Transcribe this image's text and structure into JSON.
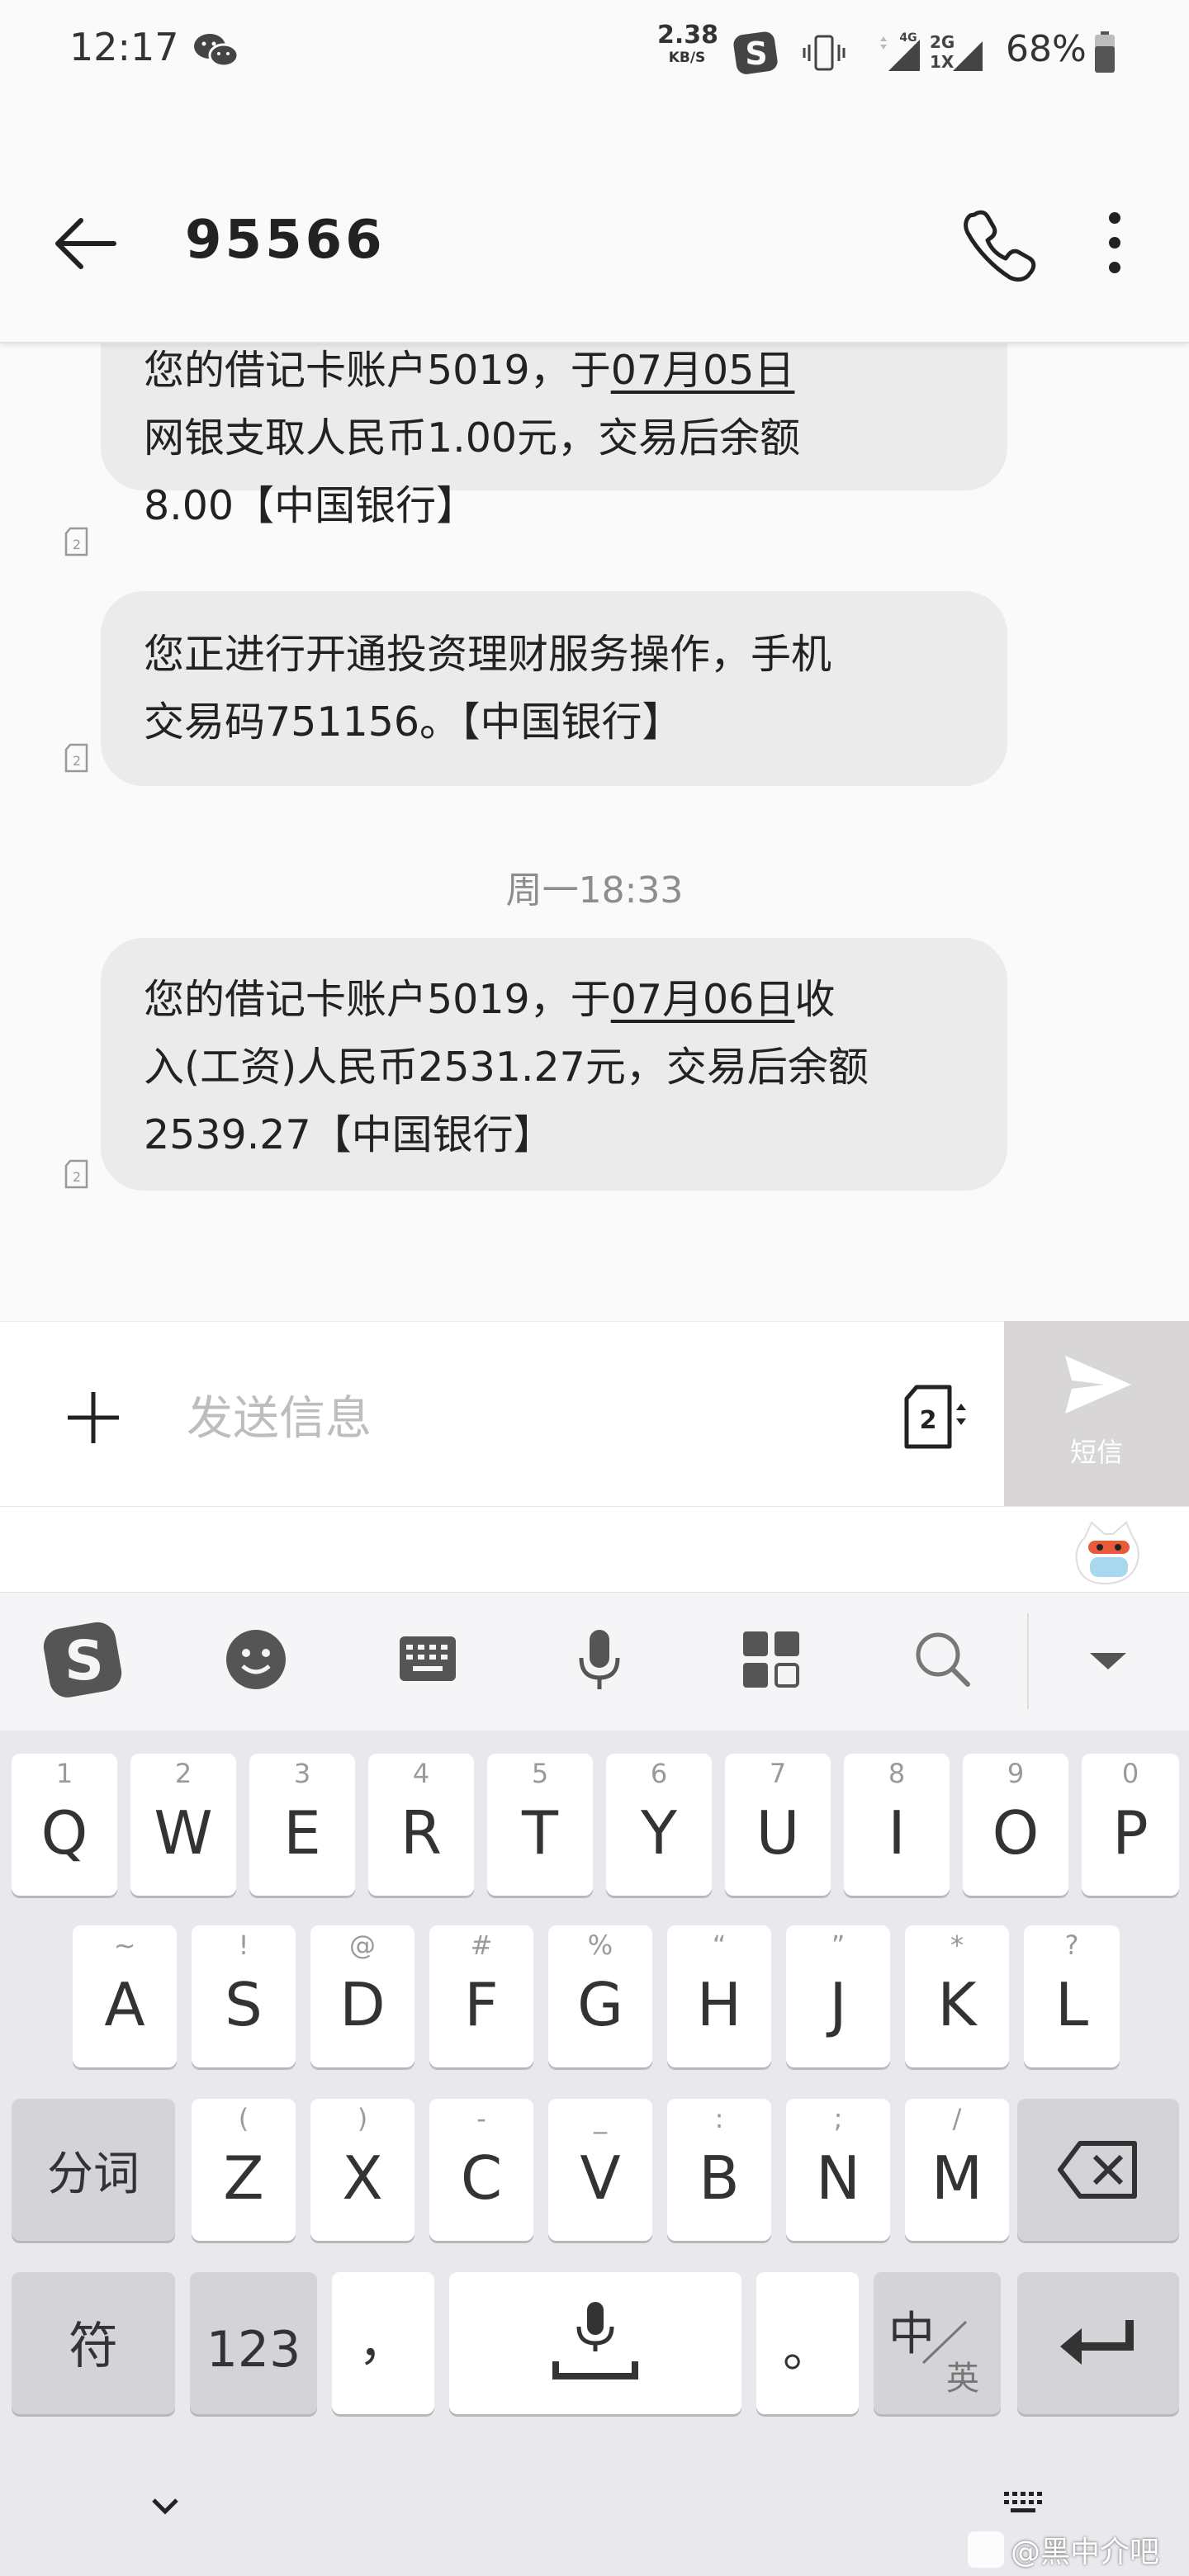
{
  "status_bar": {
    "time": "12:17",
    "net_speed_value": "2.38",
    "net_speed_unit": "KB/S",
    "signal_4g": "4G",
    "signal_2g": "2G",
    "signal_1x": "1X",
    "battery": "68%"
  },
  "header": {
    "title": "95566"
  },
  "messages": [
    {
      "lines": [
        "您的借记卡账户5019，于",
        "07月05日",
        "",
        "网银支取人民币1.00元，交易后余额",
        "8.00【中国银行】"
      ]
    },
    {
      "lines": [
        "您正进行开通投资理财服务操作，手机",
        "交易码751156。【中国银行】"
      ]
    },
    {
      "lines": [
        "您的借记卡账户5019，于",
        "07月06日",
        "收",
        "入(工资)人民币2531.27元，交易后余额",
        "2539.27【中国银行】"
      ]
    }
  ],
  "time_divider": "周一18:33",
  "sim_badge": "2",
  "compose": {
    "placeholder": "发送信息",
    "send_label": "短信",
    "sim_label": "2"
  },
  "keyboard": {
    "row1": [
      {
        "hint": "1",
        "key": "Q"
      },
      {
        "hint": "2",
        "key": "W"
      },
      {
        "hint": "3",
        "key": "E"
      },
      {
        "hint": "4",
        "key": "R"
      },
      {
        "hint": "5",
        "key": "T"
      },
      {
        "hint": "6",
        "key": "Y"
      },
      {
        "hint": "7",
        "key": "U"
      },
      {
        "hint": "8",
        "key": "I"
      },
      {
        "hint": "9",
        "key": "O"
      },
      {
        "hint": "0",
        "key": "P"
      }
    ],
    "row2": [
      {
        "hint": "~",
        "key": "A"
      },
      {
        "hint": "!",
        "key": "S"
      },
      {
        "hint": "@",
        "key": "D"
      },
      {
        "hint": "#",
        "key": "F"
      },
      {
        "hint": "%",
        "key": "G"
      },
      {
        "hint": "“",
        "key": "H"
      },
      {
        "hint": "”",
        "key": "J"
      },
      {
        "hint": "*",
        "key": "K"
      },
      {
        "hint": "?",
        "key": "L"
      }
    ],
    "row3": [
      {
        "hint": "(",
        "key": "Z"
      },
      {
        "hint": ")",
        "key": "X"
      },
      {
        "hint": "-",
        "key": "C"
      },
      {
        "hint": "_",
        "key": "V"
      },
      {
        "hint": ":",
        "key": "B"
      },
      {
        "hint": ";",
        "key": "N"
      },
      {
        "hint": "/",
        "key": "M"
      }
    ],
    "segment_key": "分词",
    "symbol_key": "符",
    "number_key": "123",
    "comma_key": "，",
    "period_key": "。",
    "lang_key_top": "中",
    "lang_key_bottom": "英"
  },
  "watermark": "@黑中介吧"
}
